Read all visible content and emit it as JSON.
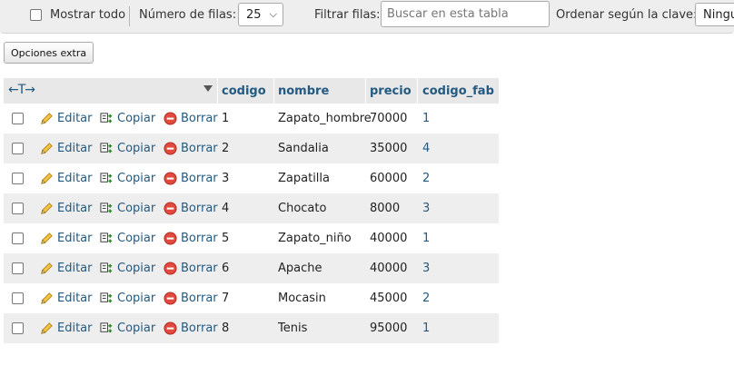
{
  "toolbar": {
    "show_all_label": "Mostrar todo",
    "rows_label": "Número de filas:",
    "rows_value": "25",
    "filter_label": "Filtrar filas:",
    "filter_placeholder": "Buscar en esta tabla",
    "sort_label": "Ordenar según la clave:",
    "sort_value": "Ninguna"
  },
  "extra_options_label": "Opciones extra",
  "table": {
    "columns": [
      "codigo",
      "nombre",
      "precio",
      "codigo_fab"
    ],
    "actions": {
      "edit": "Editar",
      "copy": "Copiar",
      "delete": "Borrar"
    },
    "rows": [
      {
        "codigo": "1",
        "nombre": "Zapato_hombre",
        "precio": "70000",
        "codigo_fab": "1"
      },
      {
        "codigo": "2",
        "nombre": "Sandalia",
        "precio": "35000",
        "codigo_fab": "4"
      },
      {
        "codigo": "3",
        "nombre": "Zapatilla",
        "precio": "60000",
        "codigo_fab": "2"
      },
      {
        "codigo": "4",
        "nombre": "Chocato",
        "precio": "8000",
        "codigo_fab": "3"
      },
      {
        "codigo": "5",
        "nombre": "Zapato_niño",
        "precio": "40000",
        "codigo_fab": "1"
      },
      {
        "codigo": "6",
        "nombre": "Apache",
        "precio": "40000",
        "codigo_fab": "3"
      },
      {
        "codigo": "7",
        "nombre": "Mocasin",
        "precio": "45000",
        "codigo_fab": "2"
      },
      {
        "codigo": "8",
        "nombre": "Tenis",
        "precio": "95000",
        "codigo_fab": "1"
      }
    ]
  },
  "colors": {
    "link": "#235a81",
    "row_alt": "#eeeeee",
    "header_bg": "#e8e8e8"
  },
  "icons": {
    "edit": "pencil-icon",
    "copy": "copy-icon",
    "delete": "delete-icon",
    "sort": "sort-arrow-icon"
  }
}
